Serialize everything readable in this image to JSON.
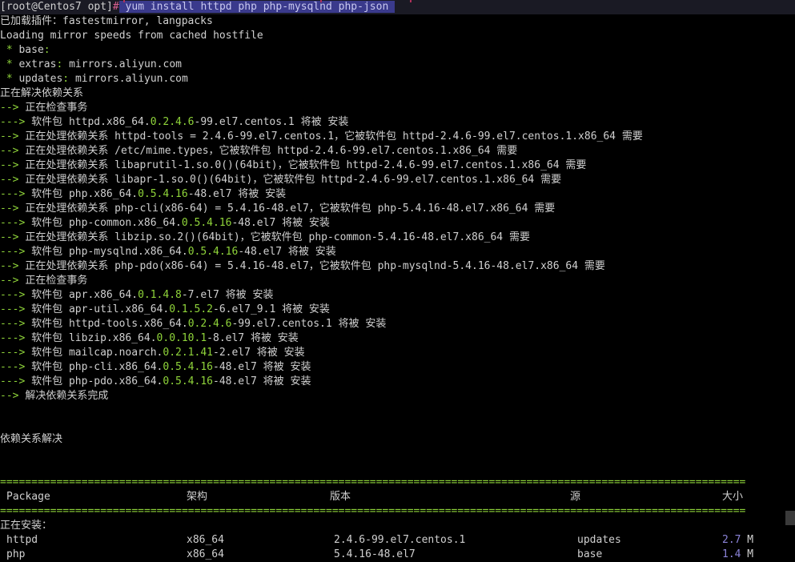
{
  "prompt": {
    "user_host": "[root@Centos7 opt]",
    "hash": "#",
    "command": " yum install httpd php php-mysqlnd php-json "
  },
  "lines": [
    [
      "已加载插件：fastestmirror, langpacks"
    ],
    [
      "Loading mirror speeds from cached hostfile"
    ],
    [
      "base",
      "",
      " * ",
      ":"
    ],
    [
      "extras",
      " mirrors.aliyun.com",
      " * ",
      ":"
    ],
    [
      "updates",
      " mirrors.aliyun.com",
      " * ",
      ":"
    ],
    [
      "正在解决依赖关系"
    ]
  ],
  "output": {
    "plugins": "已加载插件：fastestmirror, langpacks",
    "loading": "Loading mirror speeds from cached hostfile",
    "mirror_base": "base",
    "mirror_extras": "extras",
    "mirror_extras_host": "mirrors.aliyun.com",
    "mirror_updates": "updates",
    "mirror_updates_host": "mirrors.aliyun.com",
    "resolving": "正在解决依赖关系",
    "checking": "正在检查事务",
    "dep_resolved": "解决依赖关系完成",
    "deps_solved_heading": "依赖关系解决"
  },
  "transaction_lines": [
    {
      "arrow": "---> ",
      "text_a": "软件包 httpd.x86_64.",
      "ver": "0.2.4.6",
      "text_b": "-99.el7.centos.1 将被 安装"
    },
    {
      "arrow": "--> ",
      "text_a": "正在处理依赖关系 httpd-tools ",
      "ver": "",
      "text_b": "= 2.4.6-99.el7.centos.1，它被软件包 httpd-2.4.6-99.el7.centos.1.x86_64 需要"
    },
    {
      "arrow": "--> ",
      "text_a": "正在处理依赖关系 /etc/mime.types，它被软件包 httpd-2.4.6-99.el7.centos.1.x86_64 需要",
      "ver": "",
      "text_b": ""
    },
    {
      "arrow": "--> ",
      "text_a": "正在处理依赖关系 libaprutil-1.so.0()(64bit)，它被软件包 httpd-2.4.6-99.el7.centos.1.x86_64 需要",
      "ver": "",
      "text_b": ""
    },
    {
      "arrow": "--> ",
      "text_a": "正在处理依赖关系 libapr-1.so.0()(64bit)，它被软件包 httpd-2.4.6-99.el7.centos.1.x86_64 需要",
      "ver": "",
      "text_b": ""
    },
    {
      "arrow": "---> ",
      "text_a": "软件包 php.x86_64.",
      "ver": "0.5.4.16",
      "text_b": "-48.el7 将被 安装"
    },
    {
      "arrow": "--> ",
      "text_a": "正在处理依赖关系 php-cli(x86-64) ",
      "ver": "",
      "text_b": "= 5.4.16-48.el7，它被软件包 php-5.4.16-48.el7.x86_64 需要"
    },
    {
      "arrow": "---> ",
      "text_a": "软件包 php-common.x86_64.",
      "ver": "0.5.4.16",
      "text_b": "-48.el7 将被 安装"
    },
    {
      "arrow": "--> ",
      "text_a": "正在处理依赖关系 libzip.so.2()(64bit)，它被软件包 php-common-5.4.16-48.el7.x86_64 需要",
      "ver": "",
      "text_b": ""
    },
    {
      "arrow": "---> ",
      "text_a": "软件包 php-mysqlnd.x86_64.",
      "ver": "0.5.4.16",
      "text_b": "-48.el7 将被 安装"
    },
    {
      "arrow": "--> ",
      "text_a": "正在处理依赖关系 php-pdo(x86-64) ",
      "ver": "",
      "text_b": "= 5.4.16-48.el7，它被软件包 php-mysqlnd-5.4.16-48.el7.x86_64 需要"
    },
    {
      "arrow": "--> ",
      "text_a": "正在检查事务",
      "ver": "",
      "text_b": ""
    },
    {
      "arrow": "---> ",
      "text_a": "软件包 apr.x86_64.",
      "ver": "0.1.4.8",
      "text_b": "-7.el7 将被 安装"
    },
    {
      "arrow": "---> ",
      "text_a": "软件包 apr-util.x86_64.",
      "ver": "0.1.5.2",
      "text_b": "-6.el7_9.1 将被 安装"
    },
    {
      "arrow": "---> ",
      "text_a": "软件包 httpd-tools.x86_64.",
      "ver": "0.2.4.6",
      "text_b": "-99.el7.centos.1 将被 安装"
    },
    {
      "arrow": "---> ",
      "text_a": "软件包 libzip.x86_64.",
      "ver": "0.0.10.1",
      "text_b": "-8.el7 将被 安装"
    },
    {
      "arrow": "---> ",
      "text_a": "软件包 mailcap.noarch.",
      "ver": "0.2.1.41",
      "text_b": "-2.el7 将被 安装"
    },
    {
      "arrow": "---> ",
      "text_a": "软件包 php-cli.x86_64.",
      "ver": "0.5.4.16",
      "text_b": "-48.el7 将被 安装"
    },
    {
      "arrow": "---> ",
      "text_a": "软件包 php-pdo.x86_64.",
      "ver": "0.5.4.16",
      "text_b": "-48.el7 将被 安装"
    }
  ],
  "separator": "=======================================================================================================================",
  "table": {
    "headers": {
      "package": "Package",
      "arch": "架构",
      "version": "版本",
      "repo": "源",
      "size": "大小"
    },
    "installing_label": "正在安装：",
    "rows": [
      {
        "package": "httpd",
        "arch": "x86_64",
        "version": "2.4.6-99.el7.centos.1",
        "repo": "updates",
        "size_num": "2.7",
        "size_unit": " M"
      },
      {
        "package": "php",
        "arch": "x86_64",
        "version": "5.4.16-48.el7",
        "repo": "base",
        "size_num": "1.4",
        "size_unit": " M"
      }
    ]
  },
  "colors": {
    "background": "#000000",
    "text": "#d0d0d0",
    "green": "#8fd43a",
    "command_highlight": "#3a3a8c",
    "size_purple": "#8b83d8",
    "hash_pink": "#d96090"
  }
}
